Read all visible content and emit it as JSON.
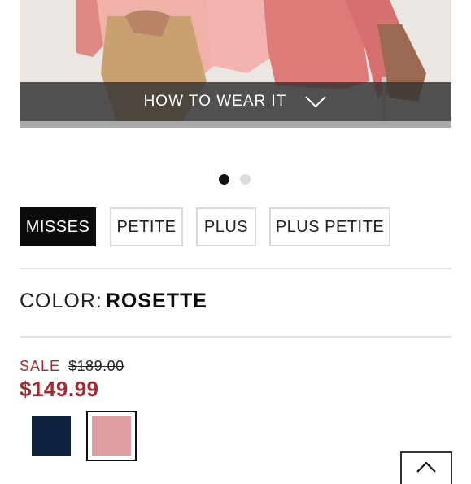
{
  "hero": {
    "cta_label": "HOW TO WEAR IT",
    "dots": [
      {
        "state": "active"
      },
      {
        "state": "inactive"
      }
    ]
  },
  "size_tabs": [
    {
      "label": "MISSES",
      "selected": true
    },
    {
      "label": "PETITE",
      "selected": false
    },
    {
      "label": "PLUS",
      "selected": false
    },
    {
      "label": "PLUS PETITE",
      "selected": false
    }
  ],
  "color": {
    "label": "COLOR:",
    "value": "ROSETTE"
  },
  "price": {
    "sale_label": "SALE",
    "original": "$189.00",
    "sale": "$149.99"
  },
  "swatches": [
    {
      "name": "navy",
      "hex": "#0d2340",
      "selected": false
    },
    {
      "name": "rosette",
      "hex": "#de9ea1",
      "selected": true
    }
  ],
  "colors": {
    "sale_red": "#a8282f",
    "dark": "#0b0b0b"
  },
  "icons": {
    "cta": "chevron-down-icon",
    "back_to_top": "chevron-up-icon"
  }
}
